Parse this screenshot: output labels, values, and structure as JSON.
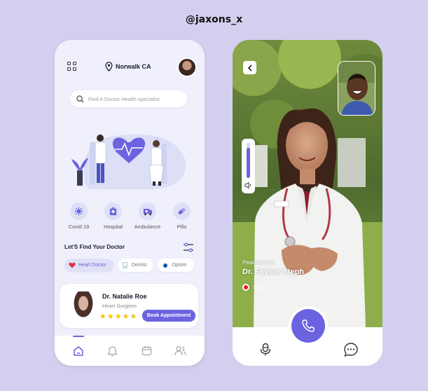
{
  "handle": "@jaxons_x",
  "home": {
    "location": "Norwalk CA",
    "search_placeholder": "Find A Doctor Health specialist",
    "categories": [
      {
        "label": "Covid 19",
        "icon": "virus-icon"
      },
      {
        "label": "Hospital",
        "icon": "hospital-icon"
      },
      {
        "label": "Ambulance",
        "icon": "ambulance-icon"
      },
      {
        "label": "Pills",
        "icon": "pill-icon"
      }
    ],
    "section_title": "Let'S Find Your Doctor",
    "chips": [
      {
        "label": "Heart Doctor",
        "icon": "heart-icon",
        "active": true
      },
      {
        "label": "Dentist",
        "icon": "tooth-icon",
        "active": false
      },
      {
        "label": "Optom",
        "icon": "eye-icon",
        "active": false
      }
    ],
    "doctor": {
      "name": "Dr. Natalie Roe",
      "role": "Heart Surgeon",
      "rating": 5,
      "book_label": "Book Appointment"
    },
    "tabs": [
      "home-icon",
      "bell-icon",
      "calendar-icon",
      "users-icon"
    ],
    "active_tab": 0
  },
  "call": {
    "specialty": "Peadiatrician",
    "doctor_name": "Dr. Favour Steph",
    "duration": "8:21",
    "volume": 0.85
  },
  "colors": {
    "accent": "#6c63e0",
    "background": "#d4cfee",
    "star": "#f4c50c",
    "record": "#ee1122"
  }
}
